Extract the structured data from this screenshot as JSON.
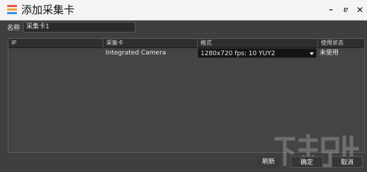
{
  "window": {
    "title": "添加采集卡",
    "minimize_label": "–",
    "restore_label": "ɐ",
    "close_label": "✕"
  },
  "form": {
    "name_label": "名称",
    "name_value": "采集卡1"
  },
  "table": {
    "columns": [
      "IP",
      "采集卡",
      "格式",
      "使用状态"
    ],
    "rows": [
      {
        "ip": "",
        "card": "Integrated Camera",
        "format": "1280x720  fps: 10  YUY2",
        "status": "未使用"
      }
    ]
  },
  "footer": {
    "refresh_label": "刷新",
    "ok_label": "确定",
    "cancel_label": "取消"
  },
  "colors": {
    "window_bg": "#3f3f3f",
    "titlebar_bg": "#f4f4f4",
    "table_bg": "#444444",
    "header_bg": "#2e2e2e",
    "selected_cell_bg": "#141414"
  },
  "icons": {
    "app": "layered-stack-icon",
    "dropdown": "chevron-down-icon",
    "watermark": "watermark-logo"
  }
}
